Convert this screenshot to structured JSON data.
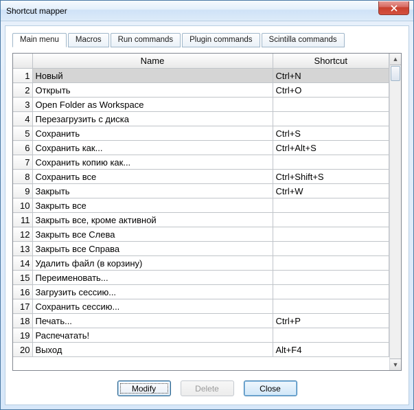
{
  "window": {
    "title": "Shortcut mapper"
  },
  "tabs": [
    {
      "label": "Main menu",
      "active": true
    },
    {
      "label": "Macros",
      "active": false
    },
    {
      "label": "Run commands",
      "active": false
    },
    {
      "label": "Plugin commands",
      "active": false
    },
    {
      "label": "Scintilla commands",
      "active": false
    }
  ],
  "columns": {
    "name": "Name",
    "shortcut": "Shortcut"
  },
  "rows": [
    {
      "n": 1,
      "name": "Новый",
      "shortcut": "Ctrl+N",
      "selected": true
    },
    {
      "n": 2,
      "name": "Открыть",
      "shortcut": "Ctrl+O"
    },
    {
      "n": 3,
      "name": "Open Folder as Workspace",
      "shortcut": ""
    },
    {
      "n": 4,
      "name": "Перезагрузить с диска",
      "shortcut": ""
    },
    {
      "n": 5,
      "name": "Сохранить",
      "shortcut": "Ctrl+S"
    },
    {
      "n": 6,
      "name": "Сохранить как...",
      "shortcut": "Ctrl+Alt+S"
    },
    {
      "n": 7,
      "name": "Сохранить копию как...",
      "shortcut": ""
    },
    {
      "n": 8,
      "name": "Сохранить все",
      "shortcut": "Ctrl+Shift+S"
    },
    {
      "n": 9,
      "name": "Закрыть",
      "shortcut": "Ctrl+W"
    },
    {
      "n": 10,
      "name": "Закрыть все",
      "shortcut": ""
    },
    {
      "n": 11,
      "name": "Закрыть все, кроме активной",
      "shortcut": ""
    },
    {
      "n": 12,
      "name": "Закрыть все Слева",
      "shortcut": ""
    },
    {
      "n": 13,
      "name": "Закрыть все Справа",
      "shortcut": ""
    },
    {
      "n": 14,
      "name": "Удалить файл (в корзину)",
      "shortcut": ""
    },
    {
      "n": 15,
      "name": "Переименовать...",
      "shortcut": ""
    },
    {
      "n": 16,
      "name": "Загрузить сессию...",
      "shortcut": ""
    },
    {
      "n": 17,
      "name": "Сохранить сессию...",
      "shortcut": ""
    },
    {
      "n": 18,
      "name": "Печать...",
      "shortcut": "Ctrl+P"
    },
    {
      "n": 19,
      "name": "Распечатать!",
      "shortcut": ""
    },
    {
      "n": 20,
      "name": "Выход",
      "shortcut": "Alt+F4"
    }
  ],
  "buttons": {
    "modify": "Modify",
    "delete": "Delete",
    "close": "Close"
  }
}
